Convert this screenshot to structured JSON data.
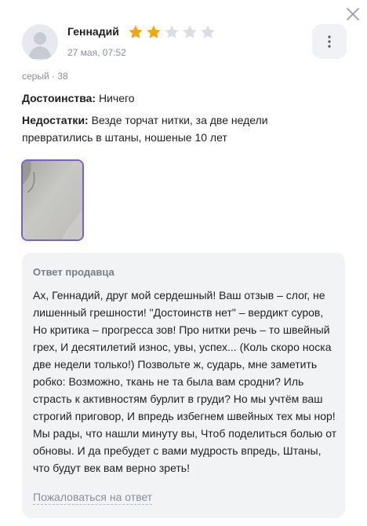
{
  "review": {
    "author": "Геннадий",
    "rating": 2,
    "rating_max": 5,
    "date": "27 мая, 07:52",
    "variant": "серый · 38",
    "pros_label": "Достоинства:",
    "pros_text": "Ничего",
    "cons_label": "Недостатки:",
    "cons_text": "Везде торчат нитки, за две недели превратились в штаны, ношеные 10 лет"
  },
  "seller_reply": {
    "title": "Ответ продавца",
    "text": "Ах, Геннадий, друг мой сердешный! Ваш отзыв – слог, не лишенный грешности! \"Достоинств нет\" – вердикт суров, Но критика – прогресса зов! Про нитки речь – то швейный грех, И десятилетий износ, увы, успех... (Коль скоро носка две недели только!) Позвольте ж, сударь, мне заметить робко: Возможно, ткань не та была вам сродни? Иль страсть к активностям бурлит в груди? Но мы учтём ваш строгий приговор, И впредь избегнем швейных тех мы нор! Мы рады, что нашли минуту вы, Чтоб поделиться болью от обновы. И да пребудет с вами мудрость впредь, Штаны, что будут век вам верно зреть!",
    "complain_label": "Пожаловаться на ответ"
  },
  "colors": {
    "star_filled": "#f6a609",
    "star_empty": "#dcdde2",
    "photo_border": "#7b5ed6"
  },
  "icons": {
    "close": "close-icon",
    "more": "more-vertical-icon",
    "avatar": "user-avatar-icon",
    "star": "star-icon"
  }
}
